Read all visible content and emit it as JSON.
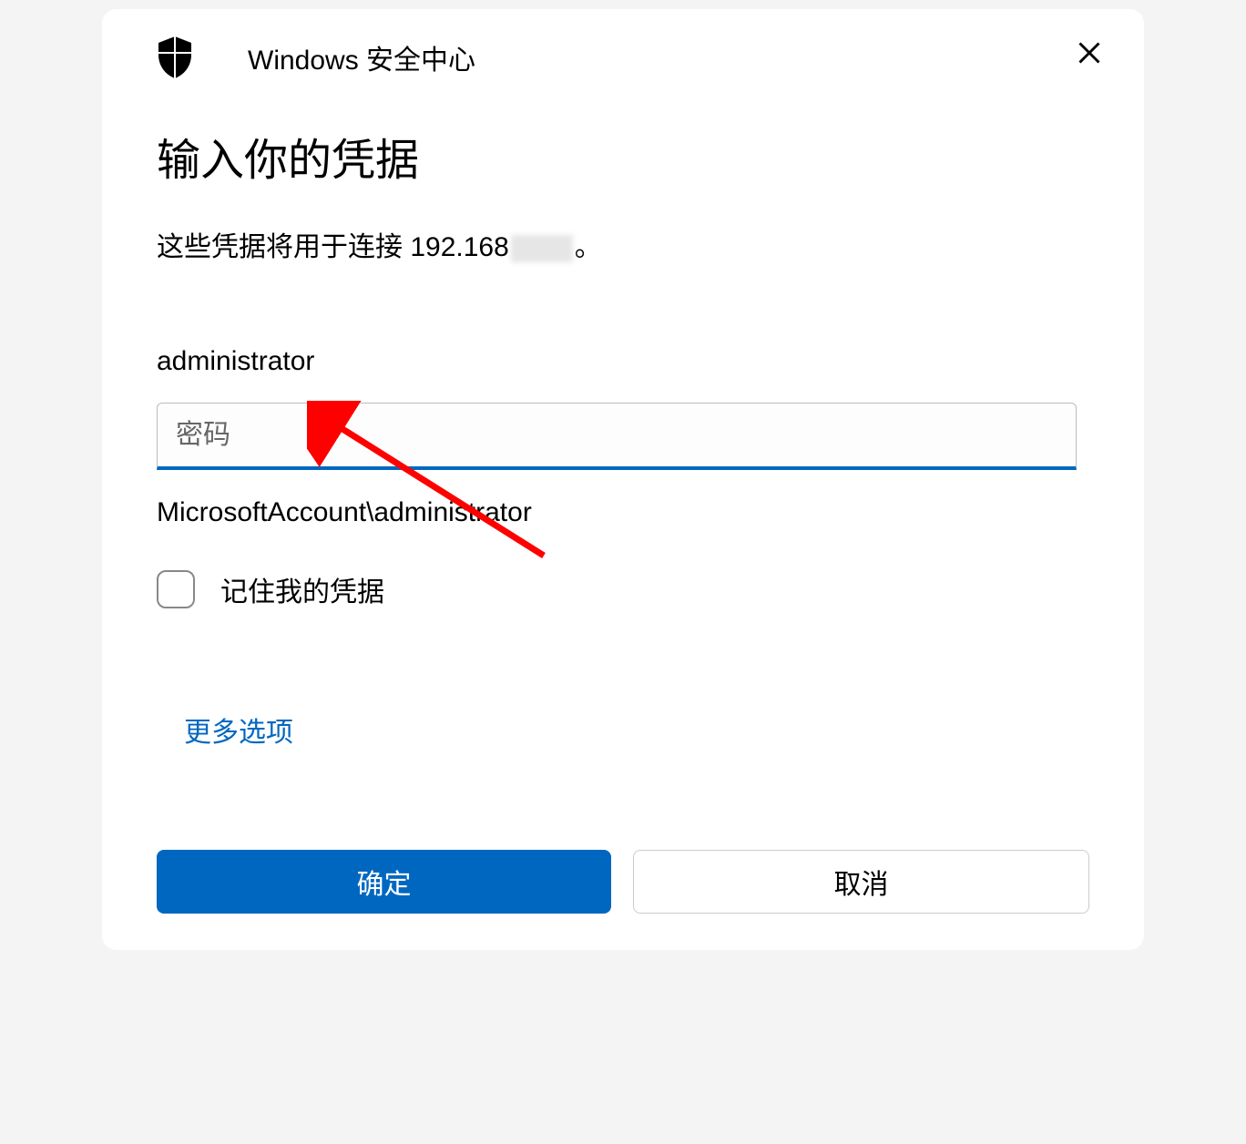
{
  "header": {
    "title": "Windows 安全中心"
  },
  "main": {
    "title": "输入你的凭据",
    "subtitle_prefix": "这些凭据将用于连接 192.168",
    "subtitle_suffix": "。",
    "username": "administrator",
    "password_placeholder": "密码",
    "password_value": "",
    "account_hint": "MicrosoftAccount\\administrator",
    "remember_label": "记住我的凭据",
    "more_options": "更多选项"
  },
  "buttons": {
    "ok": "确定",
    "cancel": "取消"
  }
}
